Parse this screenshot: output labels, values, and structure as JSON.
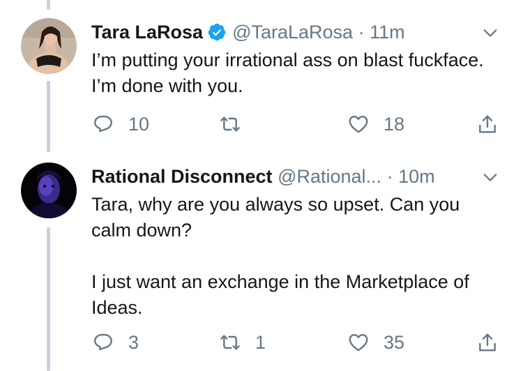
{
  "tweets": [
    {
      "name": "Tara LaRosa",
      "verified": true,
      "handle": "@TaraLaRosa",
      "separator": "·",
      "time": "11m",
      "text_lines": [
        "I’m putting your irrational ass on blast fuckface. I’m done with you."
      ],
      "replies": "10",
      "retweets": "",
      "likes": "18"
    },
    {
      "name": "Rational Disconnect",
      "verified": false,
      "handle": "@Rational...",
      "separator": "·",
      "time": "10m",
      "text_lines": [
        "Tara, why are you always so upset. Can you calm down?",
        "I just want an exchange in the Marketplace of Ideas."
      ],
      "replies": "3",
      "retweets": "1",
      "likes": "35"
    }
  ],
  "icons": {
    "reply": "reply-icon",
    "retweet": "retweet-icon",
    "like": "heart-icon",
    "share": "share-icon",
    "caret": "chevron-down-icon",
    "verified": "verified-badge-icon"
  },
  "colors": {
    "text": "#14171a",
    "secondary": "#657786",
    "verified": "#1da1f2",
    "thread_line": "#c7d1d9"
  }
}
